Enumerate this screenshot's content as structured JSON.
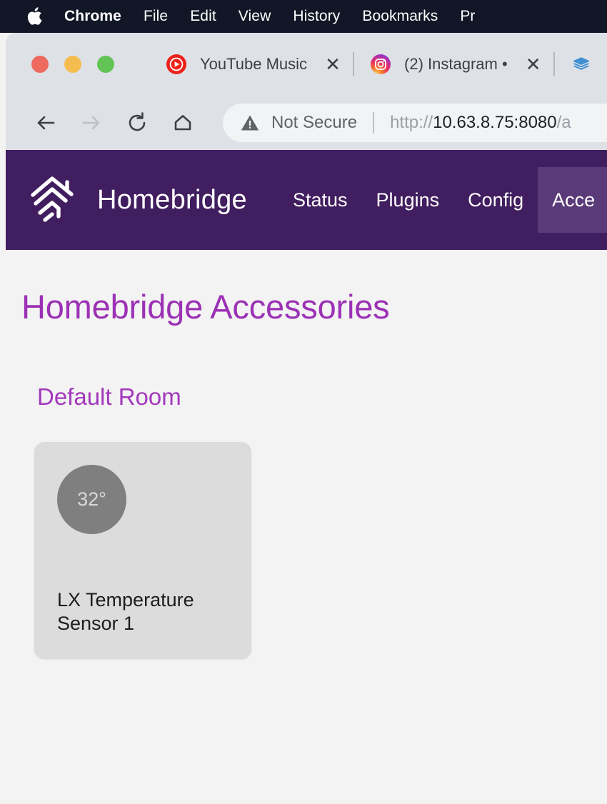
{
  "menubar": {
    "apple_icon": "apple-logo-icon",
    "items": [
      {
        "label": "Chrome",
        "bold": true
      },
      {
        "label": "File",
        "bold": false
      },
      {
        "label": "Edit",
        "bold": false
      },
      {
        "label": "View",
        "bold": false
      },
      {
        "label": "History",
        "bold": false
      },
      {
        "label": "Bookmarks",
        "bold": false
      },
      {
        "label": "Pr",
        "bold": false
      }
    ]
  },
  "browser": {
    "traffic_lights": {
      "close_color": "#ee6a5f",
      "minimize_color": "#f5bd4f",
      "maximize_color": "#61c454"
    },
    "tabs": [
      {
        "title": "YouTube Music",
        "favicon": "youtube-music-icon",
        "close_label": "✕"
      },
      {
        "title": "(2) Instagram •",
        "favicon": "instagram-icon",
        "close_label": "✕"
      },
      {
        "title": "",
        "favicon": "layers-stack-icon",
        "close_label": ""
      }
    ],
    "toolbar": {
      "back_icon": "back-arrow-icon",
      "forward_icon": "forward-arrow-icon",
      "reload_icon": "reload-icon",
      "home_icon": "home-icon",
      "security_icon": "warning-triangle-icon",
      "security_label": "Not Secure",
      "url_scheme": "http://",
      "url_host": "10.63.8.75:8080",
      "url_path": "/a"
    }
  },
  "homebridge": {
    "brand_name": "Homebridge",
    "logo_icon": "homebridge-house-icon",
    "header_color": "#411e5f",
    "active_nav_color": "#5a3a78",
    "nav": [
      {
        "label": "Status",
        "active": false
      },
      {
        "label": "Plugins",
        "active": false
      },
      {
        "label": "Config",
        "active": false
      },
      {
        "label": "Acce",
        "active": true
      }
    ],
    "page_title": "Homebridge Accessories",
    "title_color": "#9c31b5",
    "rooms": [
      {
        "name": "Default Room",
        "accessories": [
          {
            "name": "LX Temperature Sensor 1",
            "value": "32°",
            "badge_color": "#7f7f7f",
            "tile_color": "#dcdcdc"
          }
        ]
      }
    ]
  }
}
